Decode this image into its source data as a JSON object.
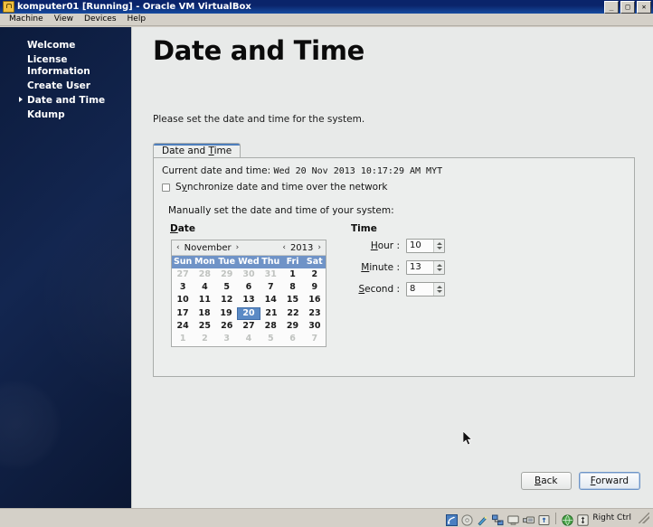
{
  "window": {
    "title": "komputer01 [Running] - Oracle VM VirtualBox",
    "icon": "vbox-machine-icon",
    "buttons": {
      "minimize": "_",
      "maximize": "□",
      "close": "✕"
    },
    "menu": [
      "Machine",
      "View",
      "Devices",
      "Help"
    ]
  },
  "sidebar": {
    "items": [
      {
        "label": "Welcome",
        "current": false
      },
      {
        "label": "License\nInformation",
        "current": false
      },
      {
        "label": "Create User",
        "current": false
      },
      {
        "label": "Date and Time",
        "current": true
      },
      {
        "label": "Kdump",
        "current": false
      }
    ]
  },
  "main": {
    "title": "Date and Time",
    "subtitle": "Please set the date and time for the system.",
    "tab_label_pre": "Date and ",
    "tab_label_accel": "T",
    "tab_label_post": "ime",
    "current_label": "Current date and time:",
    "current_value": "Wed 20 Nov 2013 10:17:29 AM MYT",
    "sync_pre": "S",
    "sync_accel": "y",
    "sync_post": "nchronize date and time over the network",
    "sync_checked": false,
    "manual_text": "Manually set the date and time of your system:",
    "date_group_label": "Date",
    "time_group_label": "Time"
  },
  "calendar": {
    "month": "November",
    "year": "2013",
    "prev_arrow": "‹",
    "next_arrow": "›",
    "weekdays": [
      "Sun",
      "Mon",
      "Tue",
      "Wed",
      "Thu",
      "Fri",
      "Sat"
    ],
    "selected_day": 20,
    "weeks": [
      [
        {
          "d": "27",
          "dim": true
        },
        {
          "d": "28",
          "dim": true
        },
        {
          "d": "29",
          "dim": true
        },
        {
          "d": "30",
          "dim": true
        },
        {
          "d": "31",
          "dim": true
        },
        {
          "d": "1",
          "dim": false
        },
        {
          "d": "2",
          "dim": false
        }
      ],
      [
        {
          "d": "3",
          "dim": false
        },
        {
          "d": "4",
          "dim": false
        },
        {
          "d": "5",
          "dim": false
        },
        {
          "d": "6",
          "dim": false
        },
        {
          "d": "7",
          "dim": false
        },
        {
          "d": "8",
          "dim": false
        },
        {
          "d": "9",
          "dim": false
        }
      ],
      [
        {
          "d": "10",
          "dim": false
        },
        {
          "d": "11",
          "dim": false
        },
        {
          "d": "12",
          "dim": false
        },
        {
          "d": "13",
          "dim": false
        },
        {
          "d": "14",
          "dim": false
        },
        {
          "d": "15",
          "dim": false
        },
        {
          "d": "16",
          "dim": false
        }
      ],
      [
        {
          "d": "17",
          "dim": false
        },
        {
          "d": "18",
          "dim": false
        },
        {
          "d": "19",
          "dim": false
        },
        {
          "d": "20",
          "dim": false,
          "selected": true
        },
        {
          "d": "21",
          "dim": false
        },
        {
          "d": "22",
          "dim": false
        },
        {
          "d": "23",
          "dim": false
        }
      ],
      [
        {
          "d": "24",
          "dim": false
        },
        {
          "d": "25",
          "dim": false
        },
        {
          "d": "26",
          "dim": false
        },
        {
          "d": "27",
          "dim": false
        },
        {
          "d": "28",
          "dim": false
        },
        {
          "d": "29",
          "dim": false
        },
        {
          "d": "30",
          "dim": false
        }
      ],
      [
        {
          "d": "1",
          "dim": true
        },
        {
          "d": "2",
          "dim": true
        },
        {
          "d": "3",
          "dim": true
        },
        {
          "d": "4",
          "dim": true
        },
        {
          "d": "5",
          "dim": true
        },
        {
          "d": "6",
          "dim": true
        },
        {
          "d": "7",
          "dim": true
        }
      ]
    ]
  },
  "time": {
    "fields": [
      {
        "accel": "H",
        "rest": "our :",
        "value": "10",
        "name": "hour"
      },
      {
        "accel": "M",
        "rest": "inute :",
        "value": "13",
        "name": "minute"
      },
      {
        "accel": "S",
        "rest": "econd :",
        "value": "8",
        "name": "second"
      }
    ]
  },
  "footer": {
    "back_accel": "B",
    "back_rest": "ack",
    "forward_accel": "F",
    "forward_rest": "orward"
  },
  "statusbar": {
    "icons": [
      "hard-disk-icon",
      "optical-disk-icon",
      "floppy-disk-icon",
      "network-icon",
      "display-icon",
      "shared-folders-icon",
      "usb-icon"
    ],
    "host_icon": "host-key-globe-icon",
    "host_modifier_icon": "host-key-badge-icon",
    "host_key": "Right Ctrl"
  },
  "colors": {
    "titlebar": "#0a246a",
    "sidebar_dark": "#0c1b3c",
    "calendar_header": "#6f93c7",
    "selected_day": "#5b8ac5",
    "panel_bg": "#eceeed",
    "page_bg": "#e8eae9"
  }
}
